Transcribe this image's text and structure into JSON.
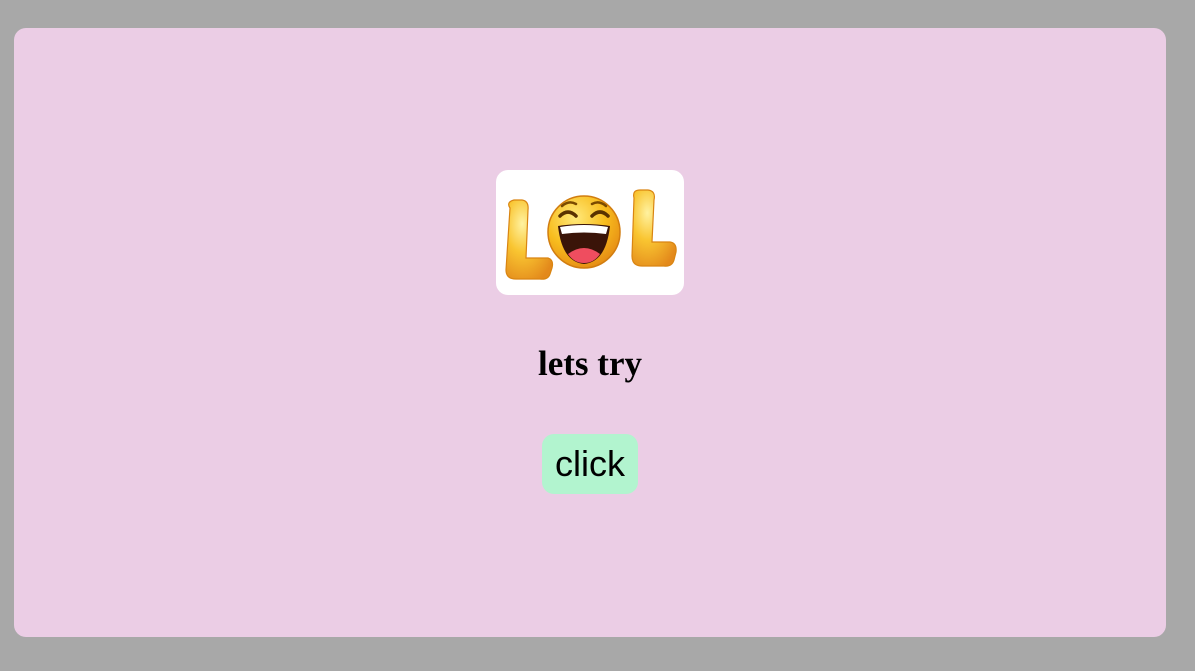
{
  "logo": {
    "letters": "LOL",
    "icon": "laughing-emoji-icon",
    "letter_color": "#f7b731",
    "face_color": "#f9c21d"
  },
  "main": {
    "heading": "lets try",
    "button_label": "click"
  },
  "colors": {
    "page_background": "#a8a8a8",
    "card_background": "#ebcde5",
    "button_background": "#b2f4cf"
  }
}
